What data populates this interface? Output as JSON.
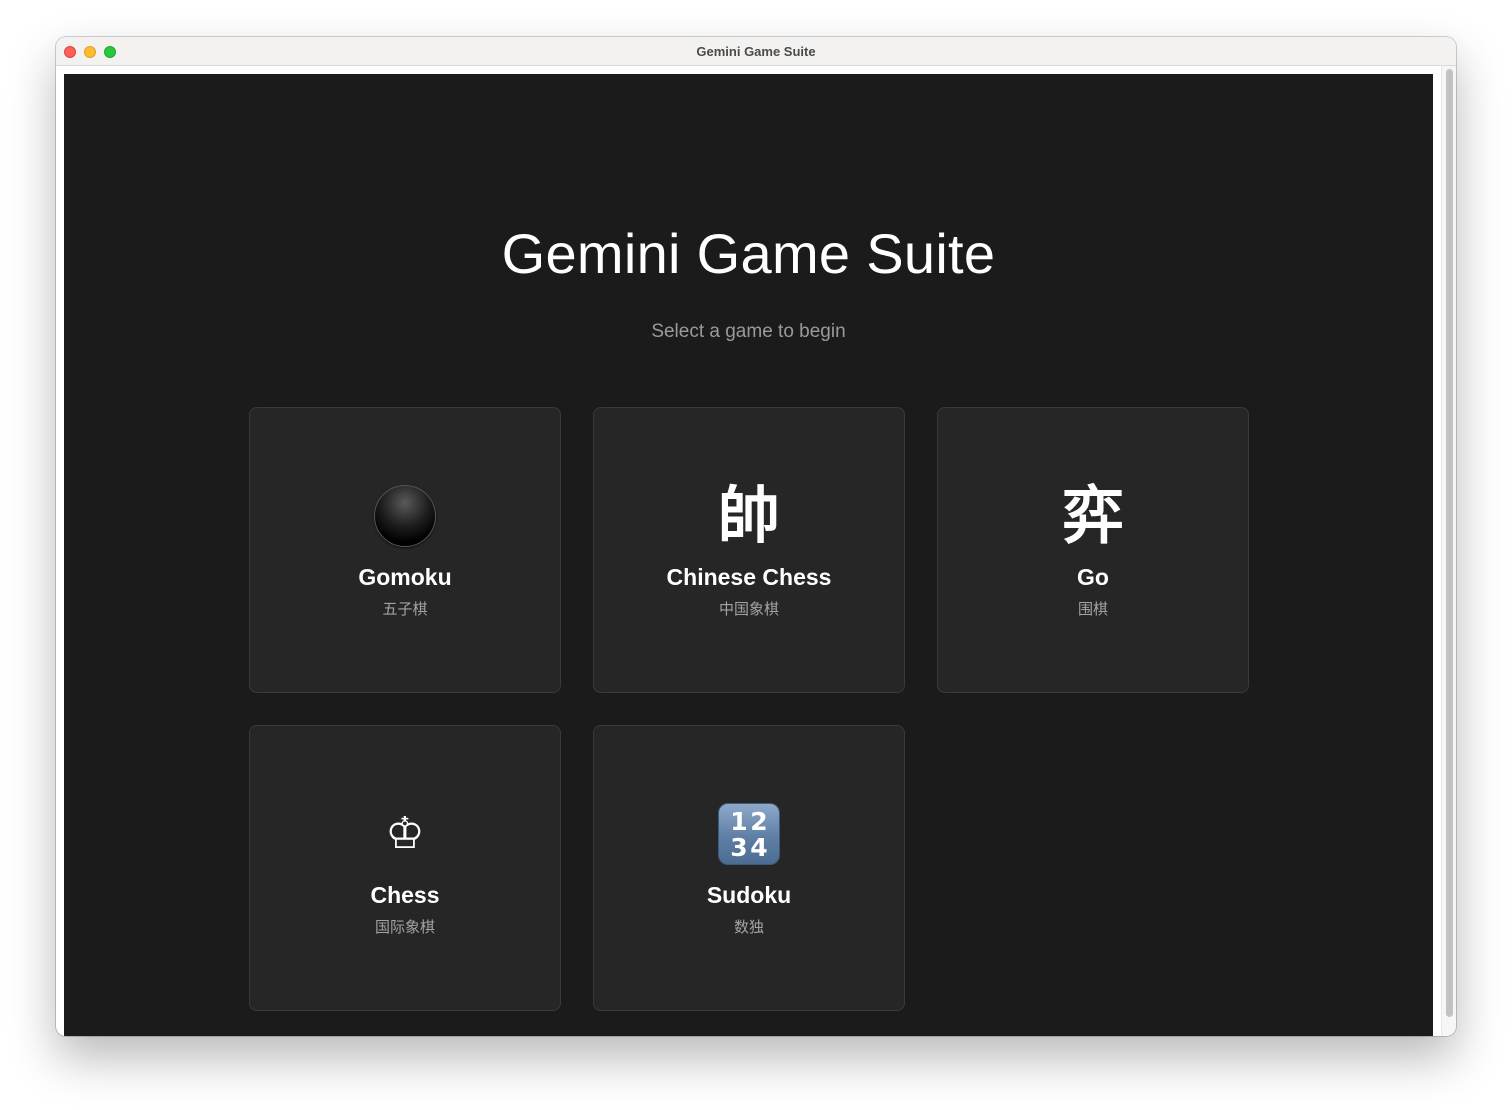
{
  "window": {
    "title": "Gemini Game Suite"
  },
  "main": {
    "title": "Gemini Game Suite",
    "subtitle": "Select a game to begin"
  },
  "games": [
    {
      "name": "Gomoku",
      "subtitle": "五子棋",
      "icon": "black-stone-icon",
      "glyph": ""
    },
    {
      "name": "Chinese Chess",
      "subtitle": "中国象棋",
      "icon": "shuai-character-icon",
      "glyph": "帥"
    },
    {
      "name": "Go",
      "subtitle": "围棋",
      "icon": "yi-character-icon",
      "glyph": "弈"
    },
    {
      "name": "Chess",
      "subtitle": "国际象棋",
      "icon": "chess-king-icon",
      "glyph": "♔"
    },
    {
      "name": "Sudoku",
      "subtitle": "数独",
      "icon": "number-tile-icon",
      "digits": [
        "1",
        "2",
        "3",
        "4"
      ]
    }
  ],
  "colors": {
    "background": "#1b1b1b",
    "card": "#262626",
    "card_border": "#3a3a3a",
    "text_primary": "#ffffff",
    "text_secondary": "#9a9a9a"
  }
}
